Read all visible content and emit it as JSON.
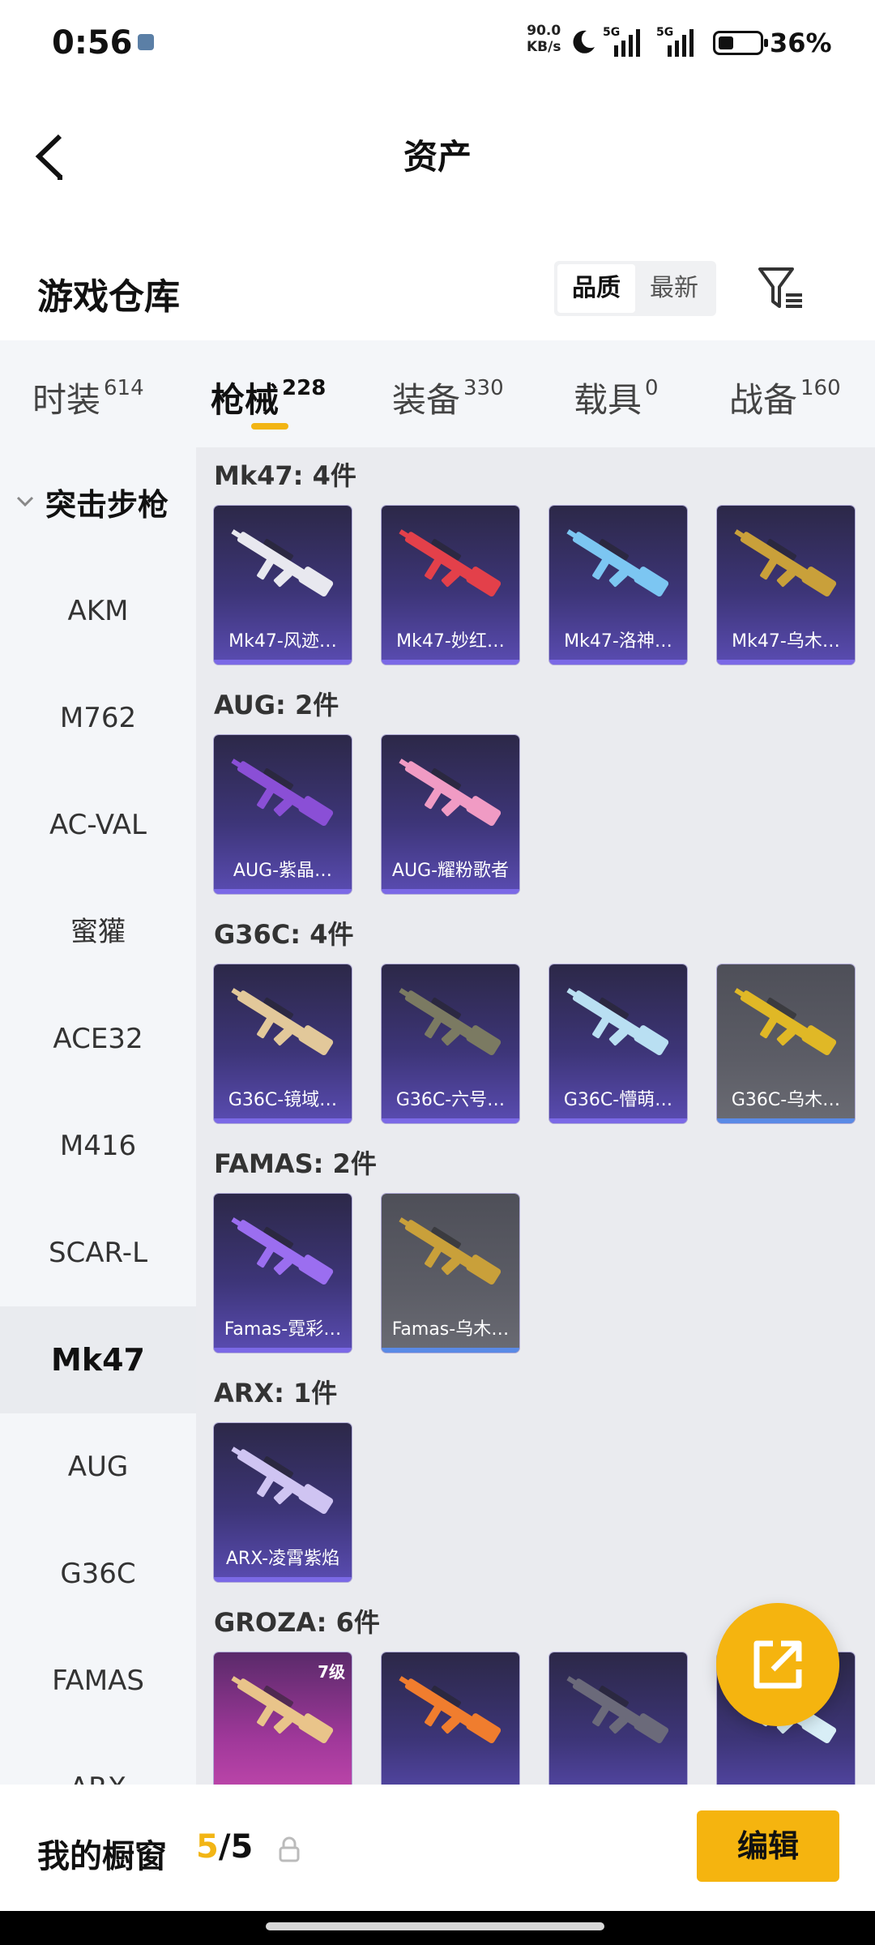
{
  "status_bar": {
    "time": "0:56",
    "net_speed_value": "90.0",
    "net_speed_unit": "KB/s",
    "network_1": "5G",
    "network_2": "5G",
    "battery_percent": "36%",
    "battery_level": 0.36
  },
  "header": {
    "title": "资产"
  },
  "warehouse": {
    "title": "游戏仓库",
    "sort_options": [
      {
        "label": "品质",
        "active": true
      },
      {
        "label": "最新",
        "active": false
      }
    ]
  },
  "tabs": [
    {
      "label": "时装",
      "count": "614",
      "active": false
    },
    {
      "label": "枪械",
      "count": "228",
      "active": true
    },
    {
      "label": "装备",
      "count": "330",
      "active": false
    },
    {
      "label": "载具",
      "count": "0",
      "active": false
    },
    {
      "label": "战备",
      "count": "160",
      "active": false
    }
  ],
  "sidebar": {
    "group_label": "突击步枪",
    "items": [
      {
        "label": "AKM",
        "active": false
      },
      {
        "label": "M762",
        "active": false
      },
      {
        "label": "AC-VAL",
        "active": false
      },
      {
        "label": "蜜獾",
        "active": false
      },
      {
        "label": "ACE32",
        "active": false
      },
      {
        "label": "M416",
        "active": false
      },
      {
        "label": "SCAR-L",
        "active": false
      },
      {
        "label": "Mk47",
        "active": true
      },
      {
        "label": "AUG",
        "active": false
      },
      {
        "label": "G36C",
        "active": false
      },
      {
        "label": "FAMAS",
        "active": false
      },
      {
        "label": "ARX",
        "active": false
      }
    ]
  },
  "groups": [
    {
      "title": "Mk47: 4件",
      "items": [
        {
          "name": "Mk47-风迹…",
          "style": "purple",
          "color": "#e8e8ef"
        },
        {
          "name": "Mk47-妙红…",
          "style": "purple",
          "color": "#e3404a"
        },
        {
          "name": "Mk47-洛神…",
          "style": "purple",
          "color": "#7cc6f2"
        },
        {
          "name": "Mk47-乌木…",
          "style": "purple",
          "color": "#c9a03a"
        }
      ]
    },
    {
      "title": "AUG: 2件",
      "items": [
        {
          "name": "AUG-紫晶…",
          "style": "purple",
          "color": "#8a4fd6"
        },
        {
          "name": "AUG-耀粉歌者",
          "style": "purple",
          "color": "#f09bc4"
        }
      ]
    },
    {
      "title": "G36C: 4件",
      "items": [
        {
          "name": "G36C-镜域…",
          "style": "purple",
          "color": "#e2c89a"
        },
        {
          "name": "G36C-六号…",
          "style": "purple",
          "color": "#7b7a62"
        },
        {
          "name": "G36C-懵萌…",
          "style": "purple",
          "color": "#b9dff2"
        },
        {
          "name": "G36C-乌木…",
          "style": "gray",
          "color": "#e0b826"
        }
      ]
    },
    {
      "title": "FAMAS: 2件",
      "items": [
        {
          "name": "Famas-霓彩…",
          "style": "purple",
          "color": "#9b6ef0"
        },
        {
          "name": "Famas-乌木…",
          "style": "gray",
          "color": "#c9a03a"
        }
      ]
    },
    {
      "title": "ARX: 1件",
      "items": [
        {
          "name": "ARX-凌霄紫焰",
          "style": "purple",
          "color": "#cfc4f2"
        }
      ]
    },
    {
      "title": "GROZA: 6件",
      "items": [
        {
          "name": "",
          "level": "7级",
          "style": "pink",
          "color": "#e9c48a"
        },
        {
          "name": "",
          "style": "purple",
          "color": "#f07d2e"
        },
        {
          "name": "",
          "style": "purple",
          "color": "#6b6a7a"
        },
        {
          "name": "",
          "style": "purple",
          "color": "#d8eef6"
        }
      ]
    }
  ],
  "bottom_bar": {
    "label": "我的橱窗",
    "current": "5",
    "total": "/5",
    "edit_label": "编辑"
  },
  "colors": {
    "accent": "#f5b40f",
    "card_bar": "#7b69e6"
  }
}
